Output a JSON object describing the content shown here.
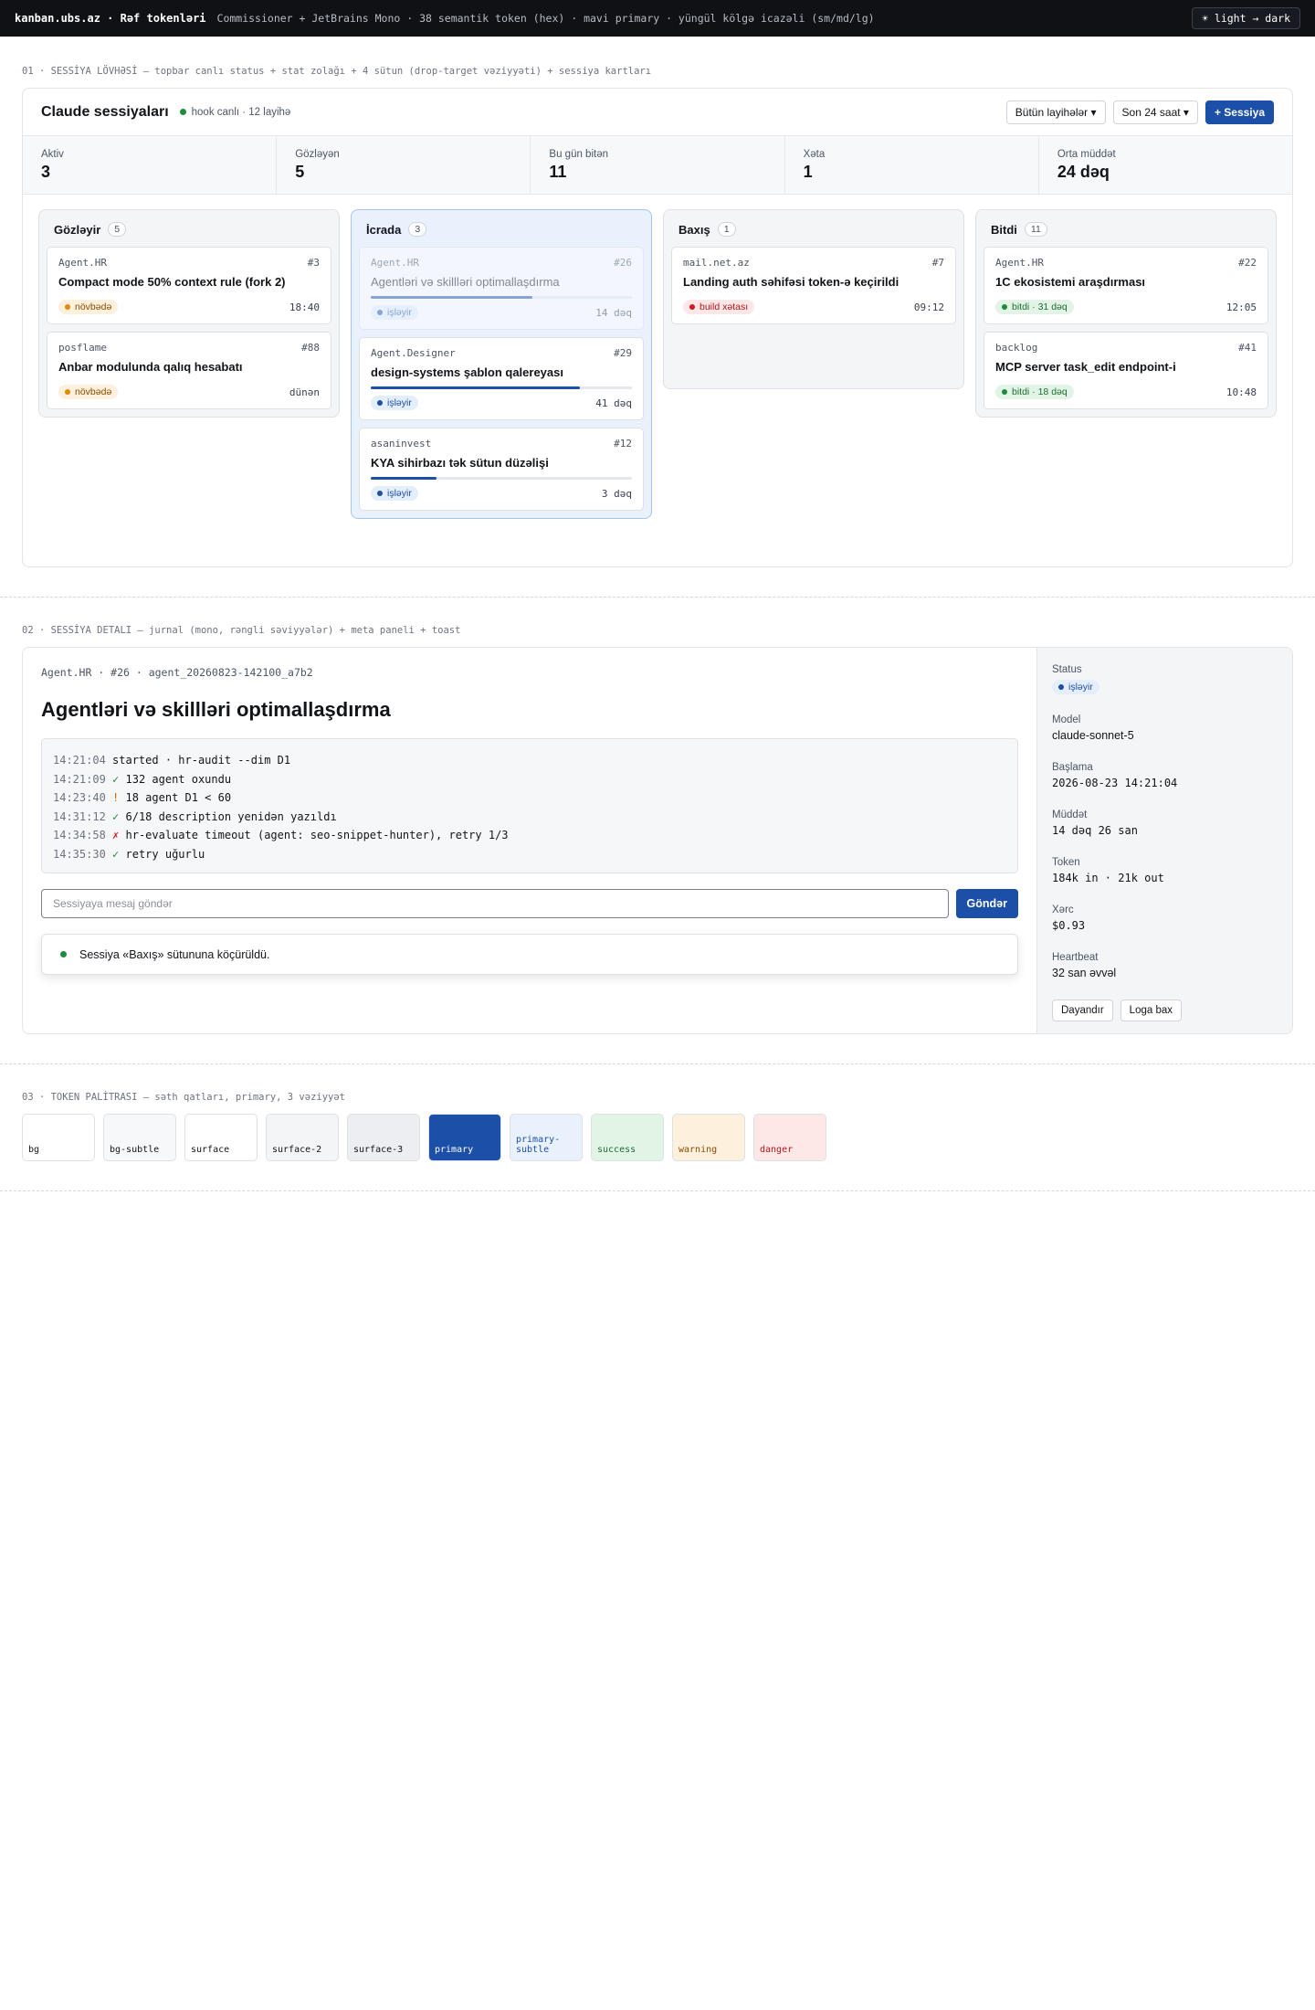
{
  "topbar": {
    "brand": "kanban.ubs.az · Rəf tokenləri",
    "subtitle": "Commissioner + JetBrains Mono · 38 semantik token (hex) · mavi primary · yüngül kölgə icazəli (sm/md/lg)",
    "theme_toggle": "☀ light → dark"
  },
  "sections": {
    "s1": "01 · SESSİYA LÖVHƏSİ — topbar canlı status + stat zolağı + 4 sütun (drop-target vəziyyəti) + sessiya kartları",
    "s2": "02 · SESSİYA DETALI — jurnal (mono, rəngli səviyyələr) + meta paneli + toast",
    "s3": "03 · TOKEN PALİTRASI — səth qatları, primary, 3 vəziyyət"
  },
  "board": {
    "title": "Claude sessiyaları",
    "live": "hook canlı · 12 layihə",
    "filter_projects": "Bütün layihələr ▾",
    "filter_time": "Son 24 saat ▾",
    "new_session": "+ Sessiya"
  },
  "stats": [
    {
      "label": "Aktiv",
      "value": "3"
    },
    {
      "label": "Gözləyən",
      "value": "5"
    },
    {
      "label": "Bu gün bitən",
      "value": "11"
    },
    {
      "label": "Xəta",
      "value": "1"
    },
    {
      "label": "Orta müddət",
      "value": "24 dəq"
    }
  ],
  "columns": [
    {
      "title": "Gözləyir",
      "count": "5",
      "cards": [
        {
          "project": "Agent.HR",
          "id": "#3",
          "title": "Compact mode 50% context rule (fork 2)",
          "status": "növbədə",
          "time": "18:40"
        },
        {
          "project": "posflame",
          "id": "#88",
          "title": "Anbar modulunda qalıq hesabatı",
          "status": "növbədə",
          "time": "dünən"
        }
      ]
    },
    {
      "title": "İcrada",
      "count": "3",
      "cards": [
        {
          "project": "Agent.HR",
          "id": "#26",
          "title": "Agentləri və skillləri optimallaşdırma",
          "status": "işləyir",
          "time": "14 dəq",
          "progress": 0.62
        },
        {
          "project": "Agent.Designer",
          "id": "#29",
          "title": "design-systems şablon qalereyası",
          "status": "işləyir",
          "time": "41 dəq",
          "progress": 0.8
        },
        {
          "project": "asaninvest",
          "id": "#12",
          "title": "KYA sihirbazı tək sütun düzəlişi",
          "status": "işləyir",
          "time": "3 dəq",
          "progress": 0.25
        }
      ]
    },
    {
      "title": "Baxış",
      "count": "1",
      "cards": [
        {
          "project": "mail.net.az",
          "id": "#7",
          "title": "Landing auth səhifəsi token-ə keçirildi",
          "status": "build xətası",
          "time": "09:12"
        }
      ]
    },
    {
      "title": "Bitdi",
      "count": "11",
      "cards": [
        {
          "project": "Agent.HR",
          "id": "#22",
          "title": "1C ekosistemi araşdırması",
          "status": "bitdi · 31 dəq",
          "time": "12:05"
        },
        {
          "project": "backlog",
          "id": "#41",
          "title": "MCP server task_edit endpoint-i",
          "status": "bitdi · 18 dəq",
          "time": "10:48"
        }
      ]
    }
  ],
  "detail": {
    "crumb": "Agent.HR · #26 · agent_20260823-142100_a7b2",
    "title": "Agentləri və skillləri optimallaşdırma",
    "journal": [
      {
        "ts": "14:21:04",
        "text": "started · hr-audit --dim D1"
      },
      {
        "ts": "14:21:09",
        "text": "✓ 132 agent oxundu"
      },
      {
        "ts": "14:23:40",
        "text": "! 18 agent D1 < 60"
      },
      {
        "ts": "14:31:12",
        "text": "✓ 6/18 description yenidən yazıldı"
      },
      {
        "ts": "14:34:58",
        "text": "✗ hr-evaluate timeout (agent: seo-snippet-hunter), retry 1/3"
      },
      {
        "ts": "14:35:30",
        "text": "✓ retry uğurlu"
      }
    ],
    "message_placeholder": "Sessiyaya mesaj göndər",
    "send": "Göndər",
    "toast": "Sessiya «Baxış» sütununa köçürüldü.",
    "meta": {
      "status_label": "Status",
      "status": "işləyir",
      "model_label": "Model",
      "model": "claude-sonnet-5",
      "start_label": "Başlama",
      "start": "2026-08-23 14:21:04",
      "duration_label": "Müddət",
      "duration": "14 dəq 26 san",
      "token_label": "Token",
      "token": "184k in · 21k out",
      "cost_label": "Xərc",
      "cost": "$0.93",
      "heartbeat_label": "Heartbeat",
      "heartbeat": "32 san əvvəl",
      "stop": "Dayandır",
      "logs": "Loga bax"
    }
  },
  "palette": [
    {
      "name": "bg",
      "bg": "#ffffff",
      "fg": "#111418"
    },
    {
      "name": "bg-subtle",
      "bg": "#f7f8fa",
      "fg": "#111418"
    },
    {
      "name": "surface",
      "bg": "#ffffff",
      "fg": "#111418"
    },
    {
      "name": "surface-2",
      "bg": "#f4f5f7",
      "fg": "#111418"
    },
    {
      "name": "surface-3",
      "bg": "#eceef1",
      "fg": "#111418"
    },
    {
      "name": "primary",
      "bg": "#1c4fa8",
      "fg": "#ffffff"
    },
    {
      "name": "primary-subtle",
      "bg": "#e9f1fd",
      "fg": "#1c4fa8"
    },
    {
      "name": "success",
      "bg": "#e2f4e6",
      "fg": "#1e6b32"
    },
    {
      "name": "warning",
      "bg": "#fdf0dc",
      "fg": "#8a4b00"
    },
    {
      "name": "danger",
      "bg": "#fde7e7",
      "fg": "#b3151b"
    }
  ],
  "colors": {
    "primary": "#1c4fa8",
    "success_dot": "#1e8a3c",
    "warning_dot": "#e08a00",
    "danger_dot": "#d11a22",
    "info_dot": "#1c4fa8",
    "journal_ok": "#1e8a3c",
    "journal_warn": "#c26a00",
    "journal_err": "#d11a22"
  }
}
